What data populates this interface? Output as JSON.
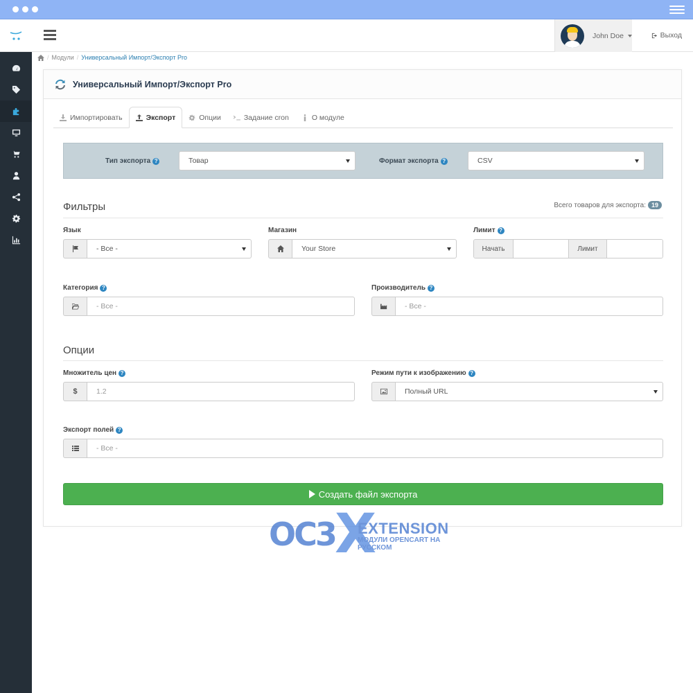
{
  "header": {
    "user_name": "John Doe",
    "logout_label": "Выход"
  },
  "breadcrumb": {
    "items": [
      "Модули",
      "Универсальный Импорт/Экспорт Pro"
    ]
  },
  "panel": {
    "title": "Универсальный Импорт/Экспорт Pro"
  },
  "tabs": [
    {
      "label": "Импортировать",
      "icon": "download-icon"
    },
    {
      "label": "Экспорт",
      "icon": "upload-icon",
      "active": true
    },
    {
      "label": "Опции",
      "icon": "gear-icon"
    },
    {
      "label": "Задание cron",
      "icon": "terminal-icon"
    },
    {
      "label": "О модуле",
      "icon": "info-icon"
    }
  ],
  "export_bar": {
    "type_label": "Тип экспорта",
    "type_value": "Товар",
    "format_label": "Формат экспорта",
    "format_value": "CSV"
  },
  "filters": {
    "title": "Фильтры",
    "total_label": "Всего товаров для экспорта:",
    "total_count": "19",
    "language_label": "Язык",
    "language_value": "- Все -",
    "store_label": "Магазин",
    "store_value": "Your Store",
    "limit_label": "Лимит",
    "limit_start_label": "Начать",
    "limit_limit_label": "Лимит",
    "category_label": "Категория",
    "category_placeholder": "- Все -",
    "manufacturer_label": "Производитель",
    "manufacturer_placeholder": "- Все -"
  },
  "options": {
    "title": "Опции",
    "price_multiplier_label": "Множитель цен",
    "price_multiplier_placeholder": "1.2",
    "currency_symbol": "$",
    "image_path_label": "Режим пути к изображению",
    "image_path_value": "Полный URL",
    "export_fields_label": "Экспорт полей",
    "export_fields_placeholder": "- Все -"
  },
  "actions": {
    "create_label": "Создать файл экспорта"
  },
  "watermark": {
    "brand_left": "OC3",
    "brand_x": "X",
    "brand_right": "EXTENSION",
    "tagline": "МОДУЛИ OPENCART НА РУССКОМ"
  },
  "colors": {
    "chrome": "#8fb4f5",
    "sidebar": "#252f38",
    "accent": "#3aa8dc",
    "primary_button": "#4cb050",
    "export_bar": "#c5d2d8"
  }
}
